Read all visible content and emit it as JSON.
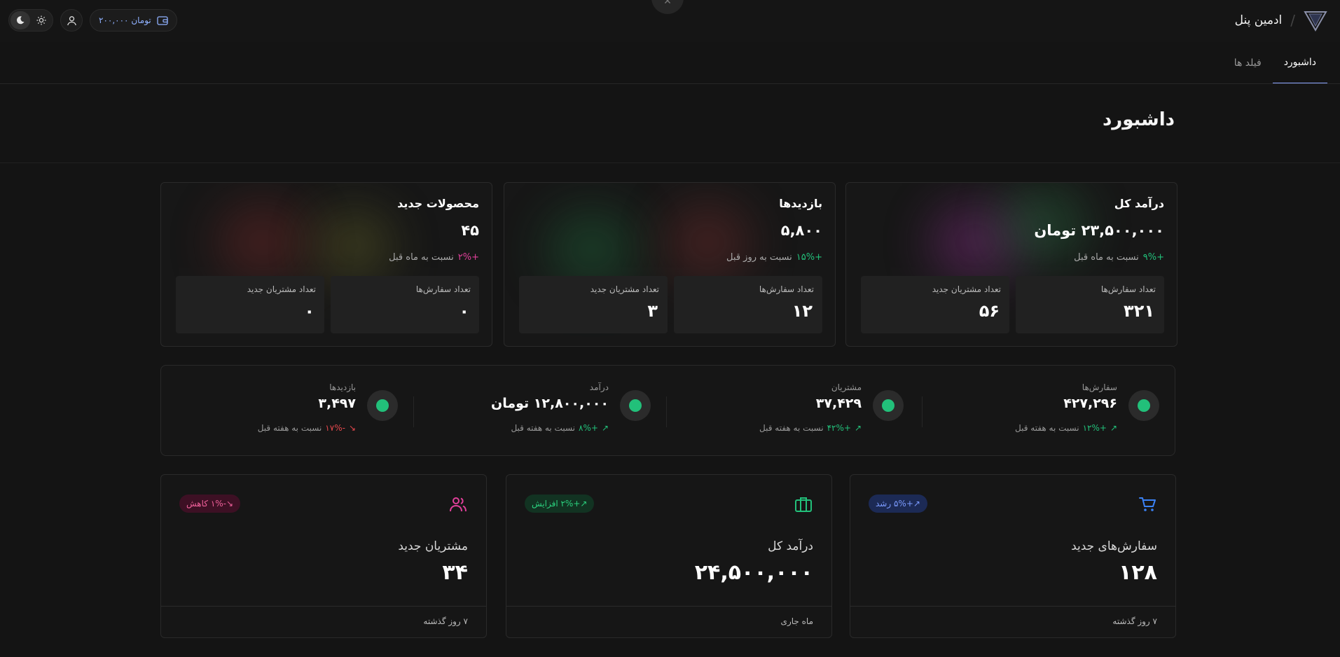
{
  "header": {
    "app_title": "ادمین پنل",
    "wallet_amount": "۲۰۰,۰۰۰ تومان",
    "close_icon": "x-icon"
  },
  "tabs": [
    {
      "label": "داشبورد",
      "active": true
    },
    {
      "label": "فیلد ها",
      "active": false
    }
  ],
  "page": {
    "title": "داشبورد"
  },
  "stat_cards": [
    {
      "title": "درآمد کل",
      "value": "۲۳,۵۰۰,۰۰۰ تومان",
      "change_pct": "+۹%",
      "change_text": "نسبت به ماه قبل",
      "change_color": "#22c07a",
      "mini": [
        {
          "label": "تعداد سفارش‌ها",
          "value": "۳۲۱"
        },
        {
          "label": "تعداد مشتریان جدید",
          "value": "۵۶"
        }
      ]
    },
    {
      "title": "بازدیدها",
      "value": "۵,۸۰۰",
      "change_pct": "+۱۵%",
      "change_text": "نسبت به روز قبل",
      "change_color": "#22c07a",
      "mini": [
        {
          "label": "تعداد سفارش‌ها",
          "value": "۱۲"
        },
        {
          "label": "تعداد مشتریان جدید",
          "value": "۳"
        }
      ]
    },
    {
      "title": "محصولات جدید",
      "value": "۴۵",
      "change_pct": "+۲%",
      "change_text": "نسبت به ماه قبل",
      "change_color": "#e0409a",
      "mini": [
        {
          "label": "تعداد سفارش‌ها",
          "value": "۰"
        },
        {
          "label": "تعداد مشتریان جدید",
          "value": "۰"
        }
      ]
    }
  ],
  "metrics": [
    {
      "title": "سفارش‌ها",
      "value": "۴۲۷,۲۹۶",
      "arrow": "↗",
      "pct": "+۱۲%",
      "text": "نسبت به هفته قبل",
      "color": "#22c07a"
    },
    {
      "title": "مشتریان",
      "value": "۳۷,۴۲۹",
      "arrow": "↗",
      "pct": "+۴۲%",
      "text": "نسبت به هفته قبل",
      "color": "#22c07a"
    },
    {
      "title": "درآمد",
      "value": "۱۲,۸۰۰,۰۰۰ تومان",
      "arrow": "↗",
      "pct": "+۸%",
      "text": "نسبت به هفته قبل",
      "color": "#22c07a"
    },
    {
      "title": "بازدیدها",
      "value": "۳,۴۹۷",
      "arrow": "↘",
      "pct": "-۱۷%",
      "text": "نسبت به هفته قبل",
      "color": "#e5484d"
    }
  ],
  "kpis": [
    {
      "icon": "cart-icon",
      "badge": "↗+۵% رشد",
      "badge_bg": "#1c2a55",
      "badge_color": "#7b9bff",
      "title": "سفارش‌های جدید",
      "value": "۱۲۸",
      "footer": "۷ روز گذشته"
    },
    {
      "icon": "briefcase-icon",
      "badge": "↗+۲% افزایش",
      "badge_bg": "#123322",
      "badge_color": "#2bd17e",
      "title": "درآمد کل",
      "value": "۲۴,۵۰۰,۰۰۰",
      "footer": "ماه جاری"
    },
    {
      "icon": "users-icon",
      "badge": "↘-۱% کاهش",
      "badge_bg": "#3d1024",
      "badge_color": "#f0609a",
      "title": "مشتریان جدید",
      "value": "۳۴",
      "footer": "۷ روز گذشته"
    }
  ],
  "colors": {
    "accent": "#8aa4ff",
    "positive": "#22c07a",
    "negative": "#e5484d"
  }
}
